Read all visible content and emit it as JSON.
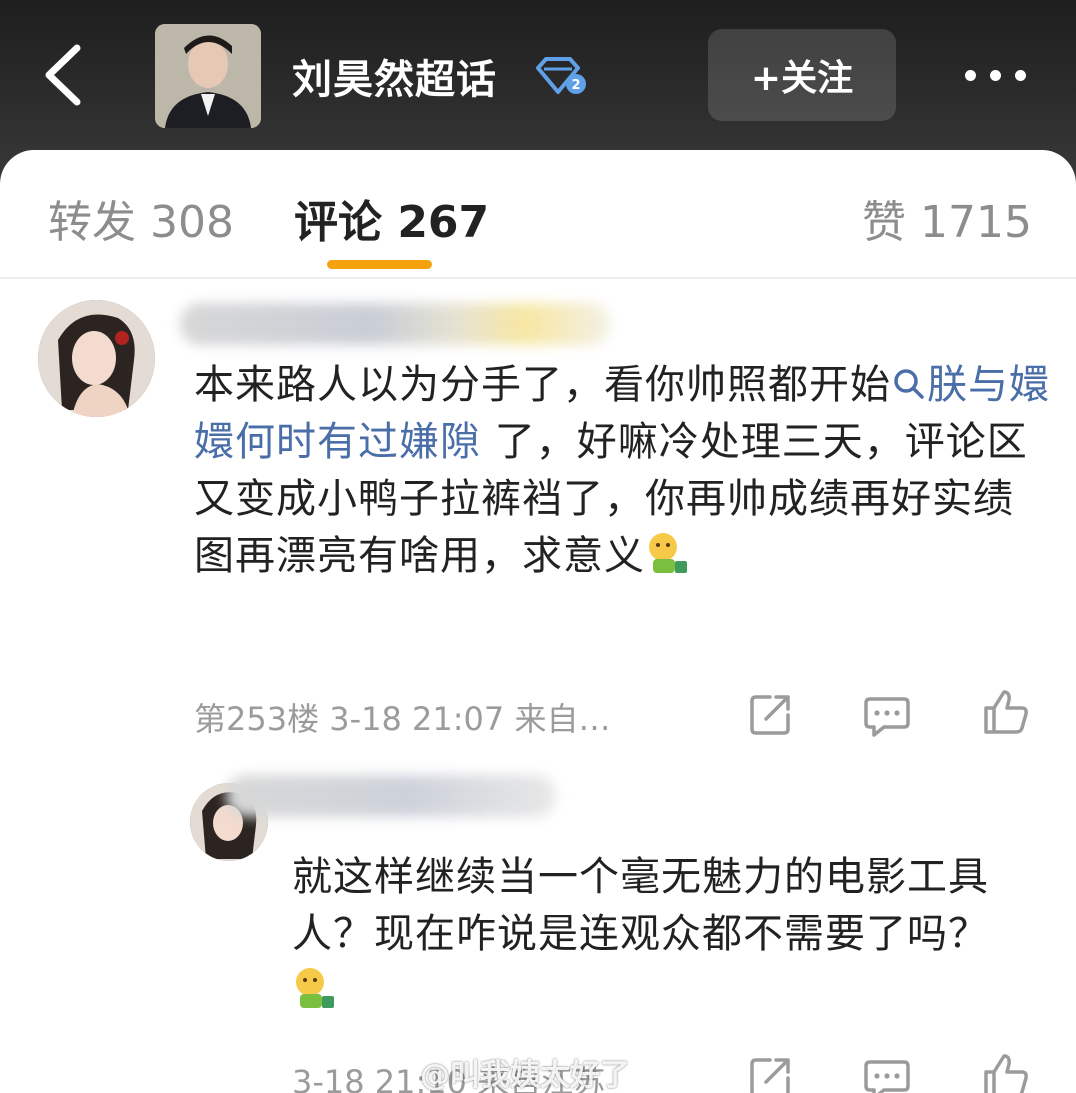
{
  "header": {
    "title": "刘昊然超话",
    "follow_label": "+关注",
    "back_icon": "chevron-left-icon",
    "more_icon": "more-dots-icon",
    "badge_icon": "diamond-level-icon"
  },
  "tabs": {
    "repost": "转发 308",
    "comment": "评论 267",
    "like": "赞 1715",
    "active": "comment",
    "accent_color": "#f4a20d"
  },
  "comments": [
    {
      "text_a": "本来路人以为分手了，看你帅照都开始",
      "topic": "朕与嬛嬛何时有过嫌隙",
      "text_b": " 了，好嘛冷处理三天，评论区又变成小鸭子拉裤裆了，你再帅成绩再好实绩图再漂亮有啥用，求意义",
      "meta": "第253楼  3-18 21:07  来自…"
    },
    {
      "text": "就这样继续当一个毫无魅力的电影工具人？现在咋说是连观众都不需要了吗？",
      "meta": "3-18 21:10  来自江苏"
    }
  ],
  "watermark": "@叫我姨太好了",
  "colors": {
    "link": "#4a6ea8",
    "meta": "#9b9b9b",
    "header_bg": "#2a2a2a"
  }
}
